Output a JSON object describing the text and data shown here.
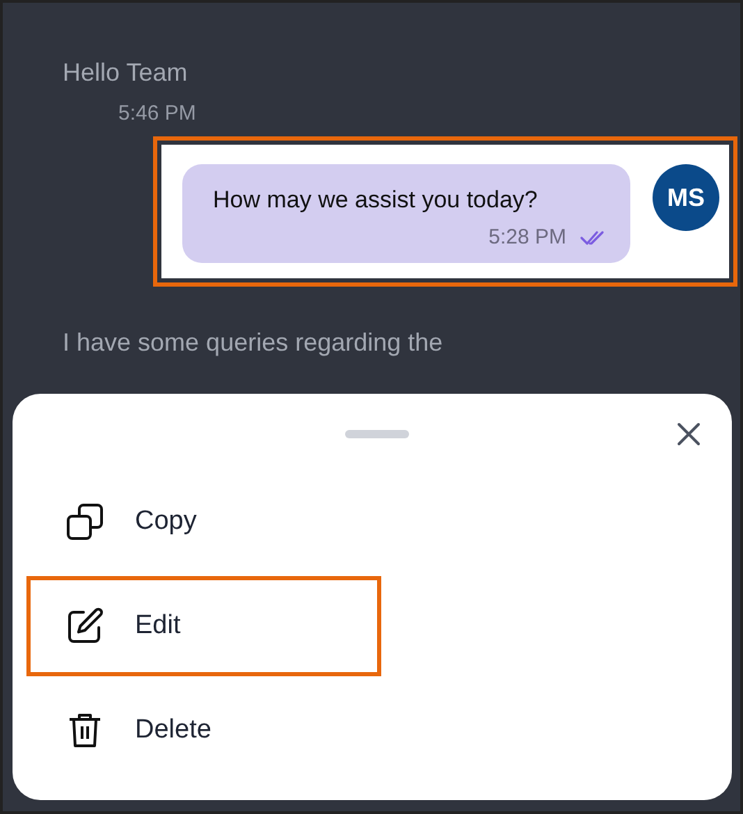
{
  "messages": [
    {
      "kind": "incoming",
      "text": "Hello Team",
      "time": "5:46 PM"
    },
    {
      "kind": "outgoing",
      "highlighted": true,
      "text": "How may we assist you today?",
      "time": "5:28 PM",
      "read": true,
      "avatar": "MS"
    },
    {
      "kind": "incoming",
      "text": "I have some queries regarding the"
    }
  ],
  "action_sheet": {
    "actions": [
      {
        "kind": "copy",
        "label": "Copy",
        "highlighted": false
      },
      {
        "kind": "edit",
        "label": "Edit",
        "highlighted": true
      },
      {
        "kind": "delete",
        "label": "Delete",
        "highlighted": false
      }
    ]
  }
}
